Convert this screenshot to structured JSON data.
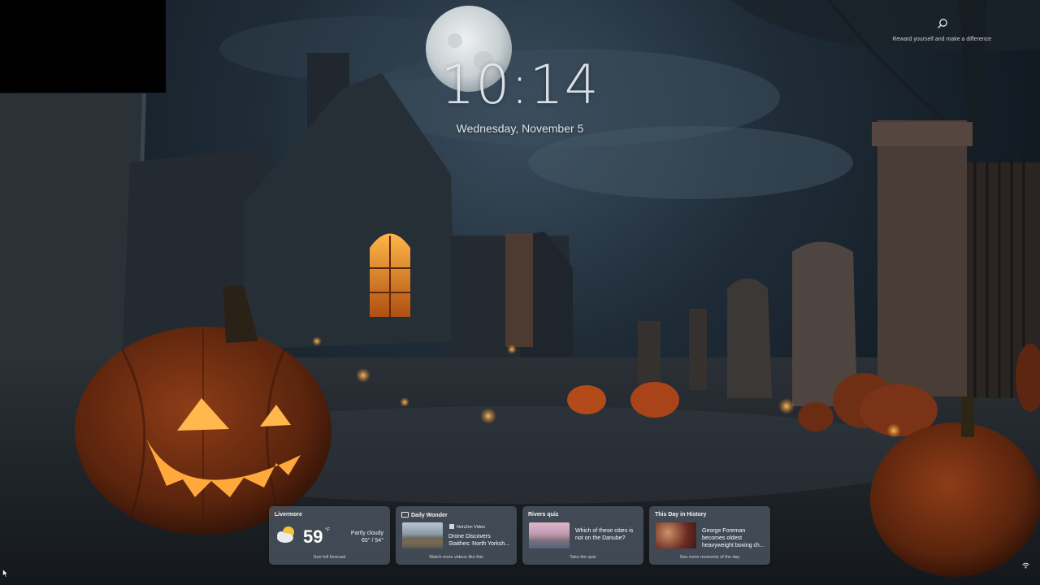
{
  "lock_screen": {
    "time": "10:14",
    "date": "Wednesday, November 5",
    "spotlight_caption": "Reward yourself and make a difference"
  },
  "icons": {
    "search": "search-icon",
    "weather": "partly-cloudy-icon",
    "video_source": "video-source-icon",
    "wifi": "wifi-icon"
  },
  "widgets": [
    {
      "title": "Livermore",
      "temperature": "59",
      "unit": "°F",
      "condition": "Partly cloudy",
      "range": "65° / 54°",
      "footer": "See full forecast"
    },
    {
      "title": "Daily Wonder",
      "source": "NonZen Video",
      "headline": "Drone Discovers Staithes: North Yorksh...",
      "footer": "Watch more videos like this"
    },
    {
      "title": "Rivers quiz",
      "headline": "Which of these cities is not on the Danube?",
      "footer": "Take the quiz"
    },
    {
      "title": "This Day in History",
      "headline": "George Foreman becomes oldest heavyweight boxing ch...",
      "footer": "See more moments of the day"
    }
  ],
  "colors": {
    "sky_dark": "#121a22",
    "moon": "#d8dde0",
    "pumpkin": "#c2571d",
    "pumpkin_glow": "#ffb347",
    "widget_bg": "#505c68"
  }
}
